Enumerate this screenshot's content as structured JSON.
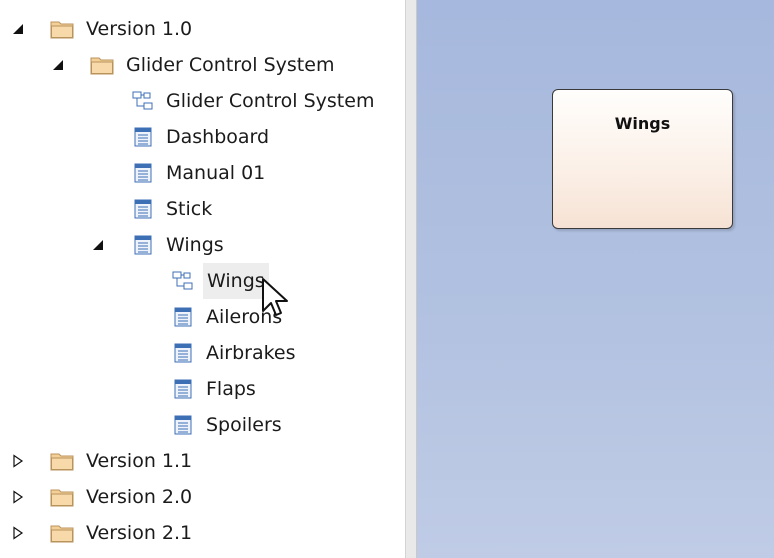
{
  "tree": {
    "items": [
      {
        "label": "Version 1.0",
        "type": "folder",
        "expand": "expanded"
      },
      {
        "label": "Glider Control System",
        "type": "folder",
        "expand": "expanded"
      },
      {
        "label": "Glider Control System",
        "type": "diagram",
        "expand": "none"
      },
      {
        "label": "Dashboard",
        "type": "element",
        "expand": "none"
      },
      {
        "label": "Manual 01",
        "type": "element",
        "expand": "none"
      },
      {
        "label": "Stick",
        "type": "element",
        "expand": "none"
      },
      {
        "label": "Wings",
        "type": "element",
        "expand": "expanded"
      },
      {
        "label": "Wings",
        "type": "diagram",
        "expand": "none",
        "hovered": true
      },
      {
        "label": "Ailerons",
        "type": "element",
        "expand": "none"
      },
      {
        "label": "Airbrakes",
        "type": "element",
        "expand": "none"
      },
      {
        "label": "Flaps",
        "type": "element",
        "expand": "none"
      },
      {
        "label": "Spoilers",
        "type": "element",
        "expand": "none"
      },
      {
        "label": "Version 1.1",
        "type": "folder",
        "expand": "collapsed"
      },
      {
        "label": "Version 2.0",
        "type": "folder",
        "expand": "collapsed"
      },
      {
        "label": "Version 2.1",
        "type": "folder",
        "expand": "collapsed"
      }
    ]
  },
  "diagram": {
    "element_name": "Wings"
  },
  "icons": {
    "folder": "folder-icon",
    "diagram": "diagram-icon",
    "element": "element-icon",
    "expanded": "expanded-triangle-icon",
    "collapsed": "collapsed-triangle-icon",
    "cursor": "mouse-pointer-icon"
  },
  "colors": {
    "canvas": "#aebee0",
    "element_fill": "#fbefe6",
    "folder_fill": "#f2c98f",
    "element_icon": "#3d6fb5"
  }
}
